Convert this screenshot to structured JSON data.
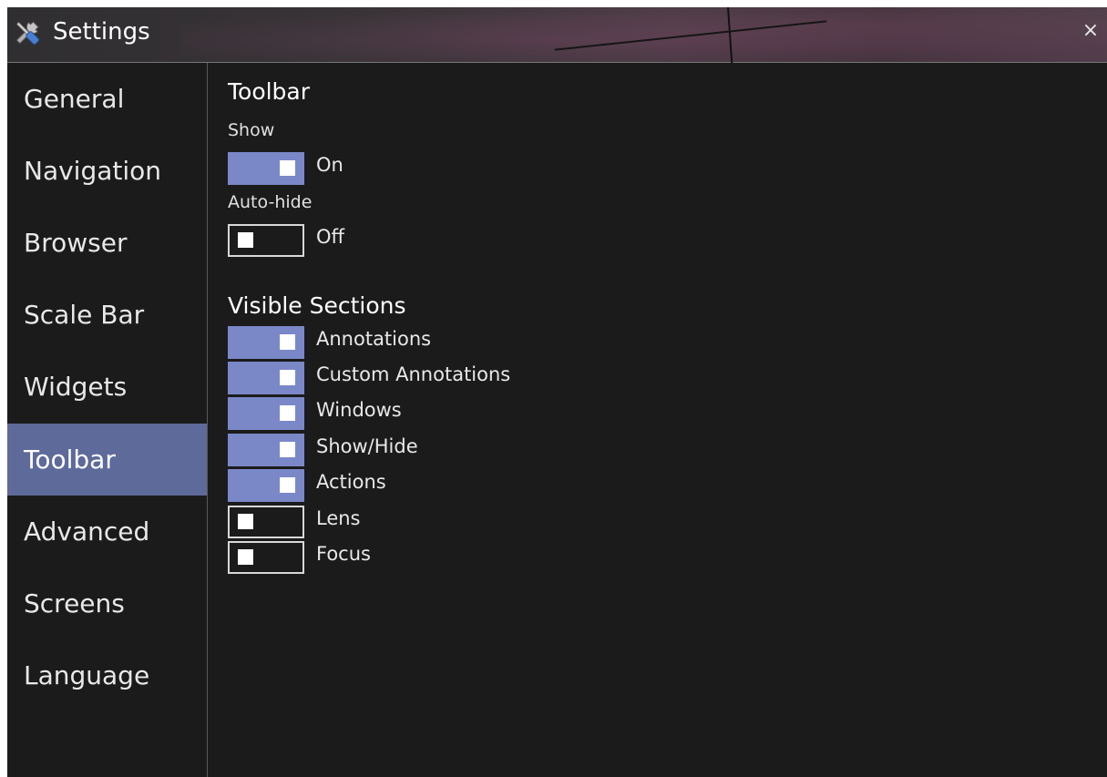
{
  "window": {
    "title": "Settings",
    "close_glyph": "×"
  },
  "sidebar": {
    "items": [
      {
        "label": "General",
        "active": false
      },
      {
        "label": "Navigation",
        "active": false
      },
      {
        "label": "Browser",
        "active": false
      },
      {
        "label": "Scale Bar",
        "active": false
      },
      {
        "label": "Widgets",
        "active": false
      },
      {
        "label": "Toolbar",
        "active": true
      },
      {
        "label": "Advanced",
        "active": false
      },
      {
        "label": "Screens",
        "active": false
      },
      {
        "label": "Language",
        "active": false
      }
    ]
  },
  "toolbar_section": {
    "title": "Toolbar",
    "show": {
      "label": "Show",
      "state_text": "On",
      "on": true
    },
    "auto_hide": {
      "label": "Auto-hide",
      "state_text": "Off",
      "on": false
    }
  },
  "visible_sections": {
    "title": "Visible Sections",
    "items": [
      {
        "label": "Annotations",
        "on": true
      },
      {
        "label": "Custom Annotations",
        "on": true
      },
      {
        "label": "Windows",
        "on": true
      },
      {
        "label": "Show/Hide",
        "on": true
      },
      {
        "label": "Actions",
        "on": true
      },
      {
        "label": "Lens",
        "on": false
      },
      {
        "label": "Focus",
        "on": false
      }
    ]
  },
  "colors": {
    "accent": "#7a88c8",
    "sidebar_active": "#5e6a9a",
    "background": "#1b1b1b"
  },
  "icons": {
    "title": "tools-icon",
    "close": "close-icon"
  }
}
